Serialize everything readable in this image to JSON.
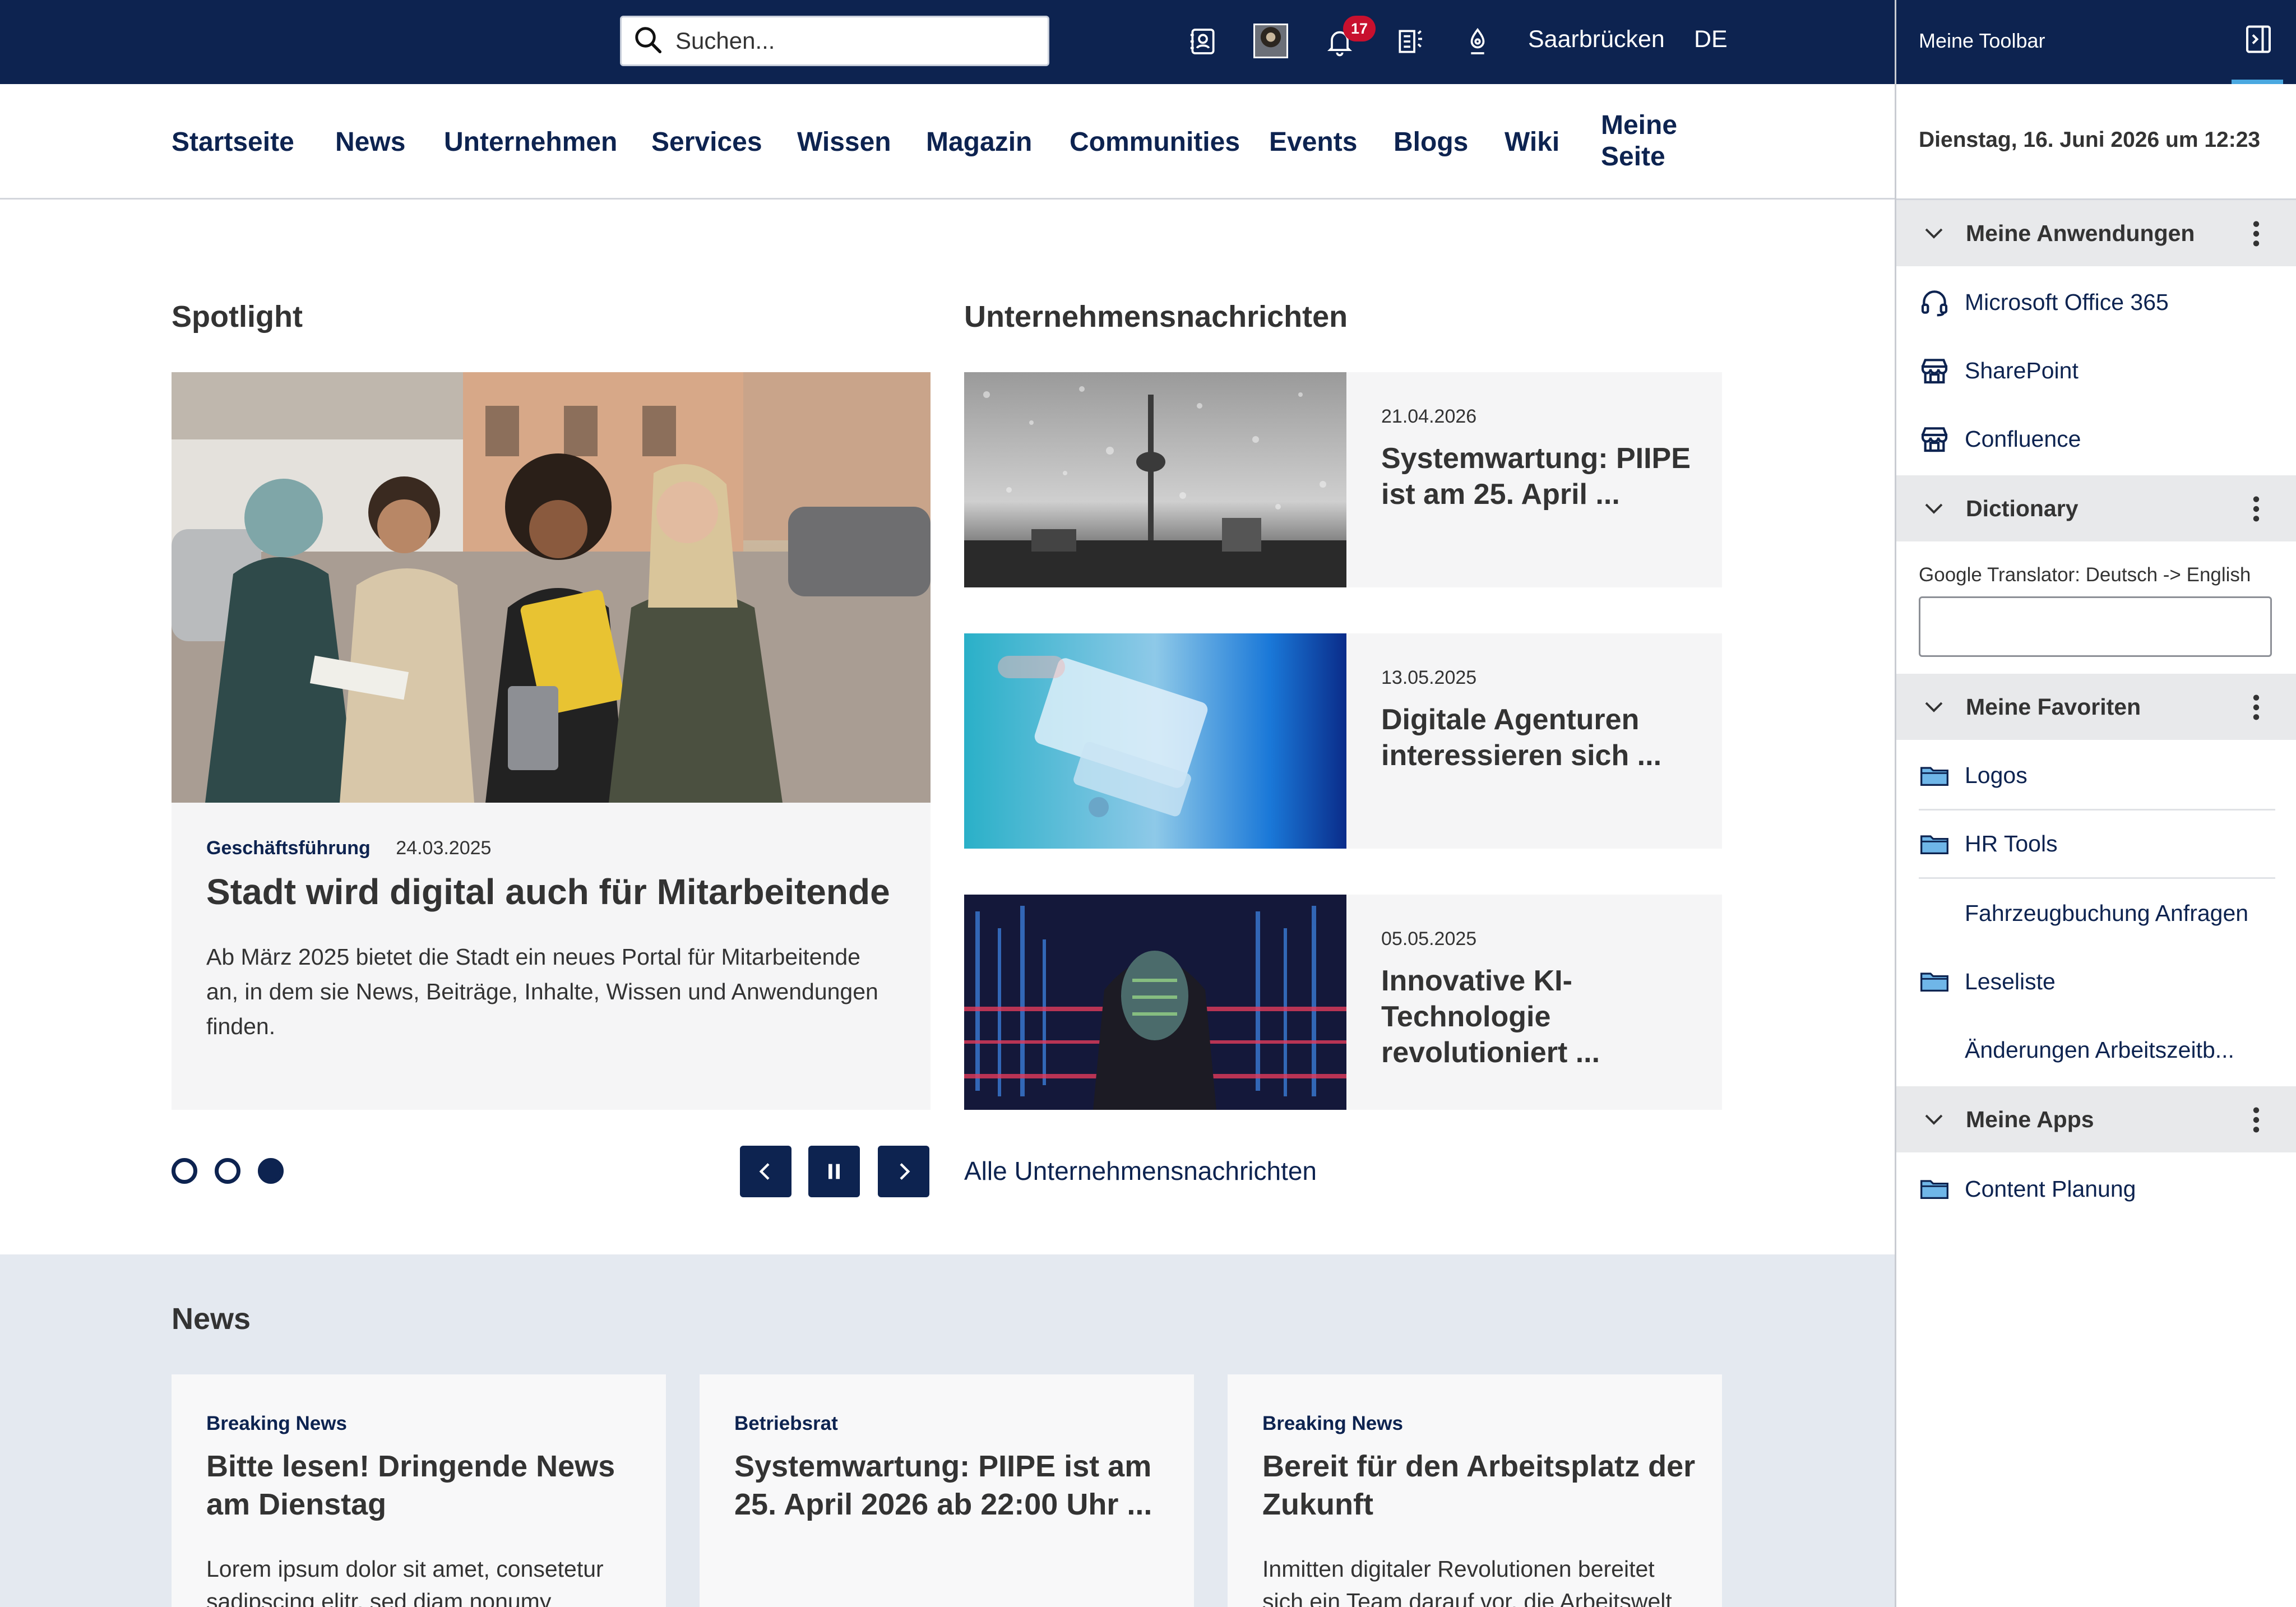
{
  "header": {
    "search_placeholder": "Suchen...",
    "notifications_count": "17",
    "location": "Saarbrücken",
    "language": "DE"
  },
  "nav": {
    "items": [
      "Startseite",
      "News",
      "Unternehmen",
      "Services",
      "Wissen",
      "Magazin",
      "Communities",
      "Events",
      "Blogs",
      "Wiki"
    ],
    "my_page_line1": "Meine",
    "my_page_line2": "Seite"
  },
  "spotlight": {
    "heading": "Spotlight",
    "category": "Geschäftsführung",
    "date": "24.03.2025",
    "title": "Stadt wird digital auch für Mitarbeitende",
    "text": "Ab März 2025 bietet die Stadt ein neues Portal für Mitarbeitende an, in dem sie News, Beiträge, Inhalte, Wissen und Anwendungen finden.",
    "slides_total": 3,
    "active_slide": 3
  },
  "company_news": {
    "heading": "Unternehmensnachrichten",
    "items": [
      {
        "date": "21.04.2026",
        "title": "Systemwartung: PIIPE ist am 25. April ..."
      },
      {
        "date": "13.05.2025",
        "title": "Digitale Agenturen interessieren sich ..."
      },
      {
        "date": "05.05.2025",
        "title": "Innovative KI-Technologie revolutioniert ..."
      }
    ],
    "all_link": "Alle Unternehmensnachrichten"
  },
  "news": {
    "heading": "News",
    "cards": [
      {
        "category": "Breaking News",
        "title": "Bitte lesen! Dringende News am Dienstag",
        "text": "Lorem ipsum dolor sit amet, consetetur sadipscing elitr, sed diam nonumy"
      },
      {
        "category": "Betriebsrat",
        "title": "Systemwartung: PIIPE ist am 25. April 2026 ab 22:00 Uhr ...",
        "text": ""
      },
      {
        "category": "Breaking News",
        "title": "Bereit für den Arbeitsplatz der Zukunft",
        "text": "Inmitten digitaler Revolutionen bereitet sich ein Team darauf vor, die Arbeitswelt"
      }
    ]
  },
  "toolbar": {
    "title": "Meine Toolbar",
    "datetime": "Dienstag, 16. Juni 2026 um 12:23",
    "applications": {
      "title": "Meine Anwendungen",
      "items": [
        "Microsoft Office 365",
        "SharePoint",
        "Confluence"
      ]
    },
    "dictionary": {
      "title": "Dictionary",
      "label": "Google Translator: Deutsch -> English",
      "value": ""
    },
    "favorites": {
      "title": "Meine Favoriten",
      "items": [
        "Logos",
        "HR Tools",
        "Fahrzeugbuchung Anfragen",
        "Leseliste",
        "Änderungen Arbeitszeitb..."
      ]
    },
    "apps": {
      "title": "Meine Apps",
      "items": [
        "Content Planung"
      ]
    }
  },
  "colors": {
    "navy": "#0d2350",
    "badge_red": "#c8102e",
    "accent_blue": "#4aa8e0",
    "news_band": "#e4e9f0"
  }
}
